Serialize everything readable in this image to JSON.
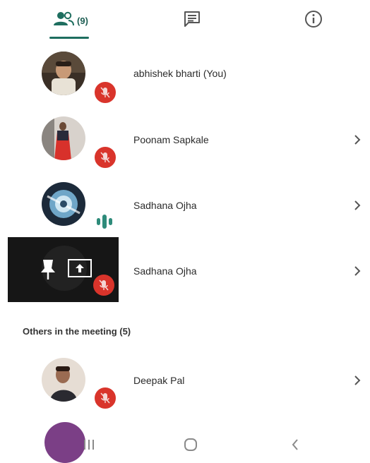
{
  "tabs": {
    "people_count": "(9)",
    "active": "people"
  },
  "participants": [
    {
      "name": "abhishek bharti (You)",
      "mic": "muted",
      "has_chevron": false
    },
    {
      "name": "Poonam Sapkale",
      "mic": "muted",
      "has_chevron": true
    },
    {
      "name": "Sadhana Ojha",
      "mic": "speaking",
      "has_chevron": true
    },
    {
      "name": "Sadhana Ojha",
      "mic": "muted",
      "has_chevron": true,
      "presenting": true
    }
  ],
  "others_section": {
    "heading": "Others in the meeting (5)",
    "participants": [
      {
        "name": "Deepak Pal",
        "mic": "muted",
        "has_chevron": true
      }
    ]
  },
  "icons": {
    "people": "people-icon",
    "chat": "chat-icon",
    "info": "info-icon",
    "muted": "mic-off-icon",
    "speaking": "audio-wave-icon",
    "pin": "pin-icon",
    "present": "screen-share-icon",
    "chevron": "chevron-right-icon",
    "nav_recents": "recents-icon",
    "nav_home": "home-icon",
    "nav_back": "back-icon"
  },
  "colors": {
    "accent": "#1e6e5f",
    "muted_badge": "#d9342b",
    "speaking": "#2e8b7a"
  }
}
